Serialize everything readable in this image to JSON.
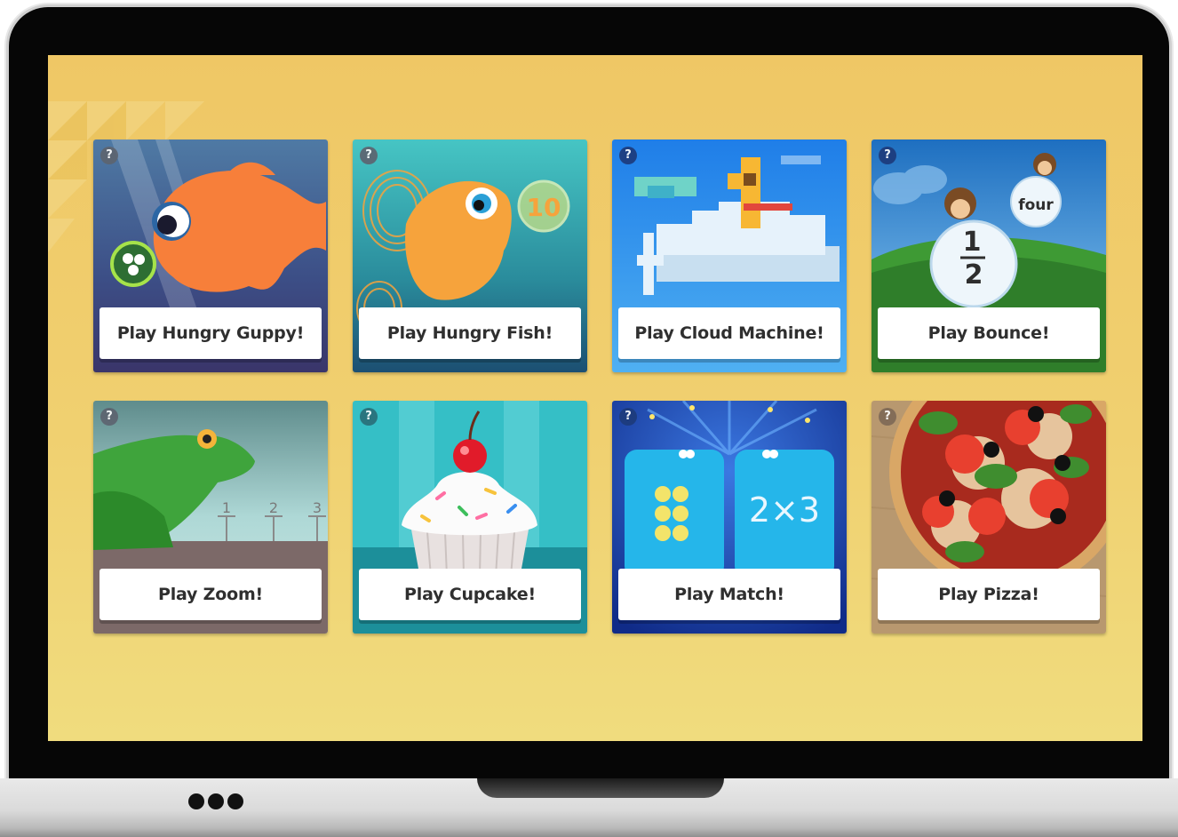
{
  "games": [
    {
      "id": "hungry-guppy",
      "label": "Play Hungry Guppy!",
      "help": "?"
    },
    {
      "id": "hungry-fish",
      "label": "Play Hungry Fish!",
      "help": "?",
      "art_text": "10"
    },
    {
      "id": "cloud-machine",
      "label": "Play Cloud Machine!",
      "help": "?"
    },
    {
      "id": "bounce",
      "label": "Play Bounce!",
      "help": "?",
      "art_text": {
        "word": "four",
        "numerator": "1",
        "denominator": "2"
      }
    },
    {
      "id": "zoom",
      "label": "Play Zoom!",
      "help": "?",
      "art_text": {
        "ticks": [
          "1",
          "2",
          "3"
        ]
      }
    },
    {
      "id": "cupcake",
      "label": "Play Cupcake!",
      "help": "?"
    },
    {
      "id": "match",
      "label": "Play Match!",
      "help": "?",
      "art_text": "2×3"
    },
    {
      "id": "pizza",
      "label": "Play Pizza!",
      "help": "?"
    }
  ],
  "colors": {
    "screen_background": "#efc765",
    "card_label_bg": "#ffffff",
    "label_text": "#2f2f2f",
    "help_badge": "#5d6470"
  }
}
